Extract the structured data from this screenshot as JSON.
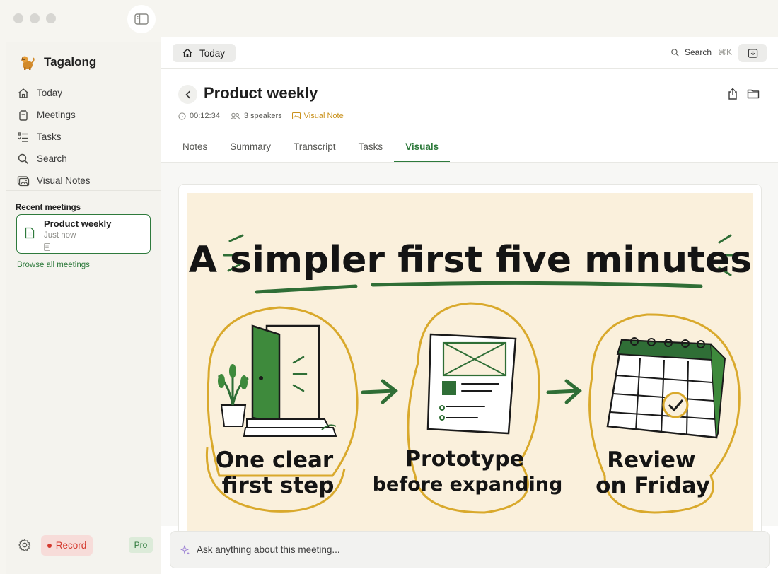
{
  "app": {
    "name": "Tagalong"
  },
  "sidebar": {
    "nav": [
      {
        "label": "Today",
        "icon": "home-icon"
      },
      {
        "label": "Meetings",
        "icon": "meetings-icon"
      },
      {
        "label": "Tasks",
        "icon": "tasks-icon"
      },
      {
        "label": "Search",
        "icon": "search-icon"
      },
      {
        "label": "Visual Notes",
        "icon": "image-gallery-icon"
      }
    ],
    "recent_title": "Recent meetings",
    "recent": [
      {
        "title": "Product weekly",
        "time": "Just now"
      }
    ],
    "browse_label": "Browse all meetings",
    "record_label": "Record",
    "pro_label": "Pro"
  },
  "topbar": {
    "today_label": "Today",
    "search_label": "Search",
    "search_shortcut": "⌘K"
  },
  "meeting": {
    "title": "Product weekly",
    "duration": "00:12:34",
    "speakers": "3 speakers",
    "visual_note_label": "Visual Note"
  },
  "tabs": [
    {
      "label": "Notes",
      "active": false
    },
    {
      "label": "Summary",
      "active": false
    },
    {
      "label": "Transcript",
      "active": false
    },
    {
      "label": "Tasks",
      "active": false
    },
    {
      "label": "Visuals",
      "active": true
    }
  ],
  "visual": {
    "headline": "A simpler first five minutes",
    "steps": [
      {
        "line1": "One clear",
        "line2": "first step"
      },
      {
        "line1": "Prototype",
        "line2": "before expanding"
      },
      {
        "line1": "Review",
        "line2": "on Friday"
      }
    ]
  },
  "ask": {
    "placeholder": "Ask anything about this meeting..."
  },
  "colors": {
    "accent": "#2e7a3c",
    "record": "#d43a2f",
    "visual_note": "#c9911c",
    "illustration_bg": "#faf0dc",
    "gold": "#d9a92c"
  }
}
